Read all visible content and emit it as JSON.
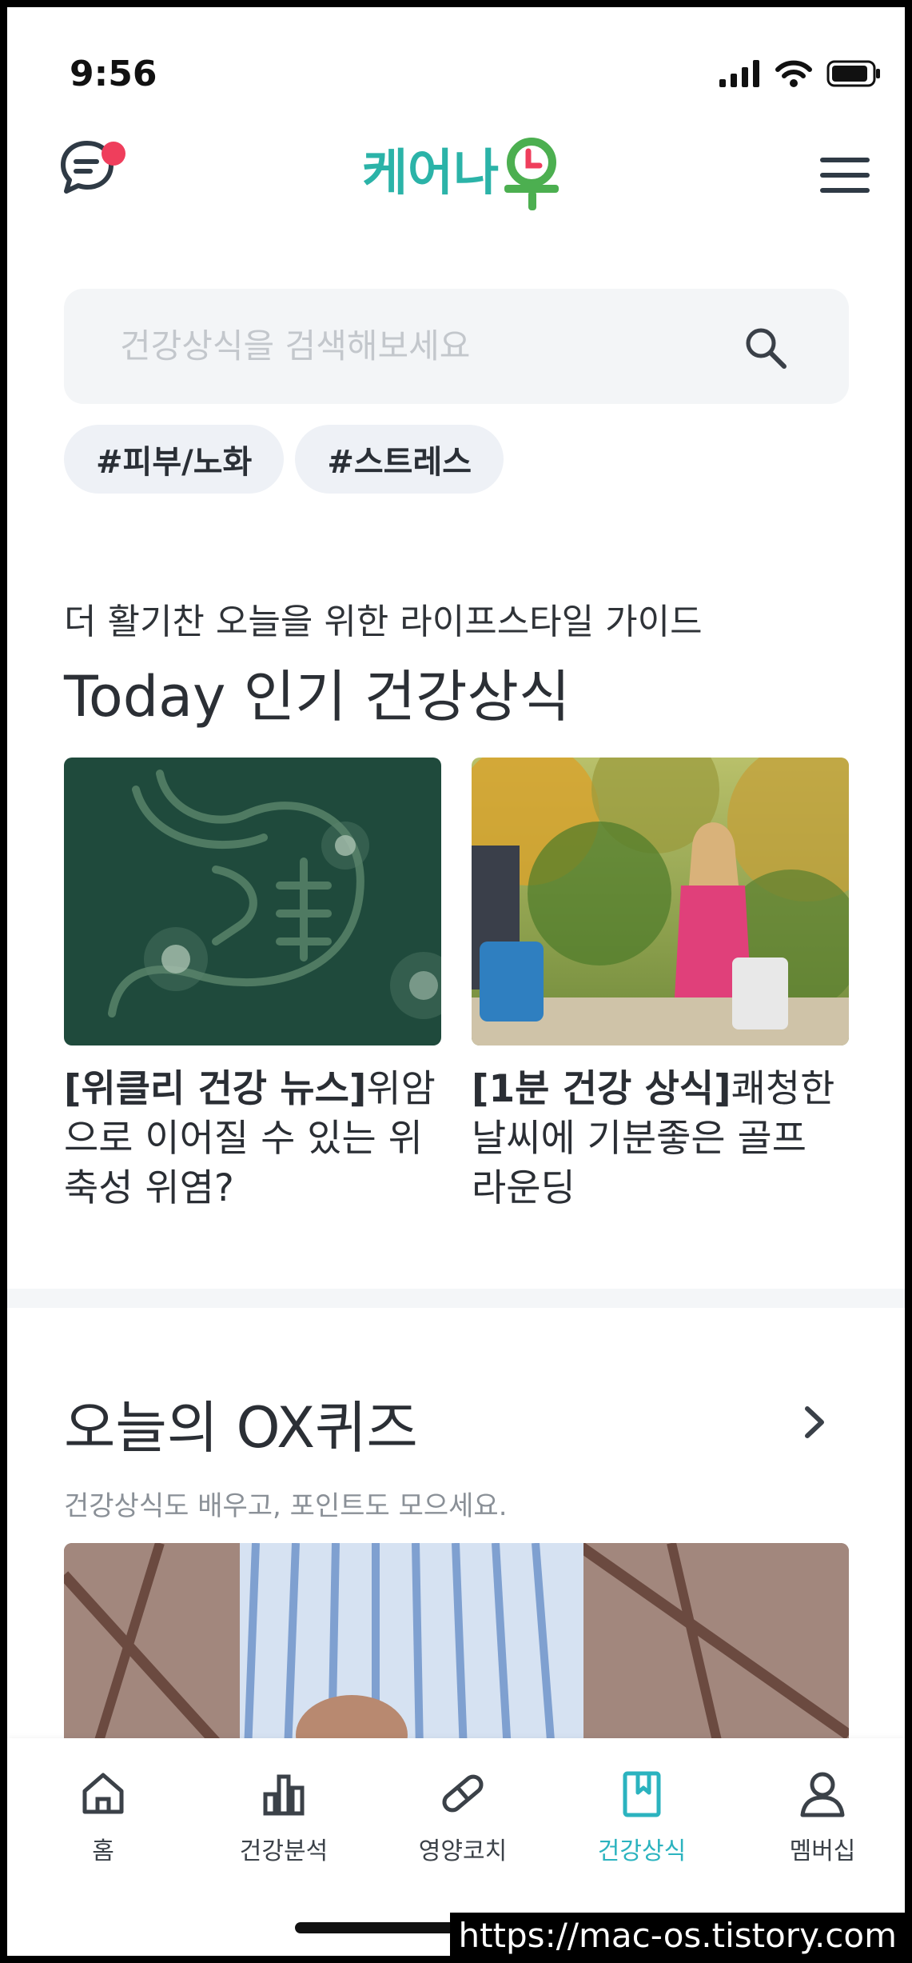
{
  "status_bar": {
    "time": "9:56"
  },
  "header": {
    "logo_text": "케어나우",
    "colors": {
      "brand_teal": "#2bb3a8",
      "brand_green": "#4caf50",
      "notification": "#ef3e5c"
    }
  },
  "search": {
    "placeholder": "건강상식을 검색해보세요"
  },
  "tags": [
    "#피부/노화",
    "#스트레스"
  ],
  "popular": {
    "subtitle": "더 활기찬 오늘을 위한 라이프스타일 가이드",
    "title": "Today 인기 건강상식",
    "cards": [
      {
        "bold": "[위클리 건강 뉴스]",
        "text": "위암으로 이어질 수 있는 위축성 위염?"
      },
      {
        "bold": "[1분 건강 상식]",
        "text": "쾌청한 날씨에 기분좋은 골프 라운딩"
      }
    ]
  },
  "quiz": {
    "title": "오늘의 OX퀴즈",
    "subtitle": "건강상식도 배우고, 포인트도 모으세요."
  },
  "bottom_nav": {
    "items": [
      {
        "label": "홈",
        "icon": "home-icon"
      },
      {
        "label": "건강분석",
        "icon": "bar-chart-icon"
      },
      {
        "label": "영양코치",
        "icon": "pill-icon"
      },
      {
        "label": "건강상식",
        "icon": "bookmark-book-icon",
        "active": true
      },
      {
        "label": "멤버십",
        "icon": "person-icon"
      }
    ],
    "active_color": "#2bb3bf"
  },
  "watermark": "https://mac-os.tistory.com"
}
